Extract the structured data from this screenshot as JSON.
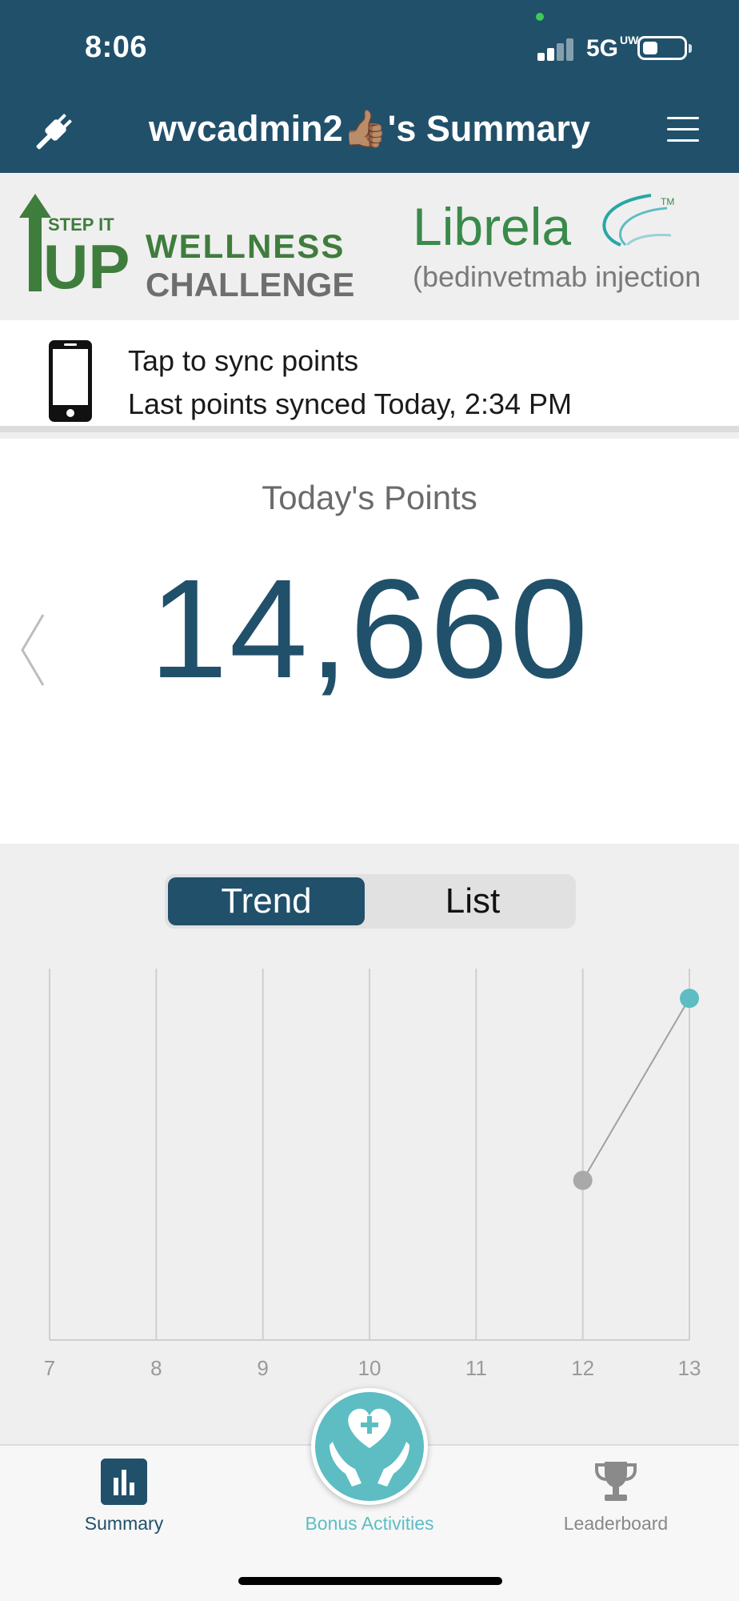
{
  "status_bar": {
    "time": "8:06",
    "network": "5G",
    "network_badge": "UW",
    "battery_level": 0.35
  },
  "nav": {
    "title": "wvcadmin2👍🏽's Summary"
  },
  "sponsors": {
    "left_logo": {
      "line1": "STEP IT",
      "line2": "UP",
      "line3": "WELLNESS",
      "line4": "CHALLENGE"
    },
    "right_logo": {
      "name": "Librela",
      "tm": "TM",
      "subtitle": "(bedinvetmab injection)"
    }
  },
  "sync": {
    "action_label": "Tap to sync points",
    "last_synced": "Last points synced Today, 2:34 PM"
  },
  "points": {
    "label": "Today's Points",
    "value": "14,660"
  },
  "view_toggle": {
    "trend_label": "Trend",
    "list_label": "List",
    "selected": "Trend"
  },
  "chart_data": {
    "type": "line",
    "x": [
      7,
      8,
      9,
      10,
      11,
      12,
      13
    ],
    "tick_labels": [
      "7",
      "8",
      "9",
      "10",
      "11",
      "12",
      "13"
    ],
    "series": [
      {
        "points": [
          {
            "x": 12,
            "y": 0.43
          },
          {
            "x": 13,
            "y": 0.92
          }
        ]
      }
    ],
    "xlim": [
      7,
      13
    ],
    "ylim": [
      0,
      1
    ],
    "grid": "vertical",
    "colors": {
      "past_point": "#a9a9a9",
      "current_point": "#5dbdc3",
      "line": "#a0a0a0",
      "grid": "#cfcfcf"
    }
  },
  "tabbar": {
    "summary_label": "Summary",
    "bonus_label": "Bonus Activities",
    "leaderboard_label": "Leaderboard"
  },
  "colors": {
    "brand_navy": "#21506b",
    "accent_teal": "#5dbdc3",
    "logo_green": "#3f7d3c"
  }
}
